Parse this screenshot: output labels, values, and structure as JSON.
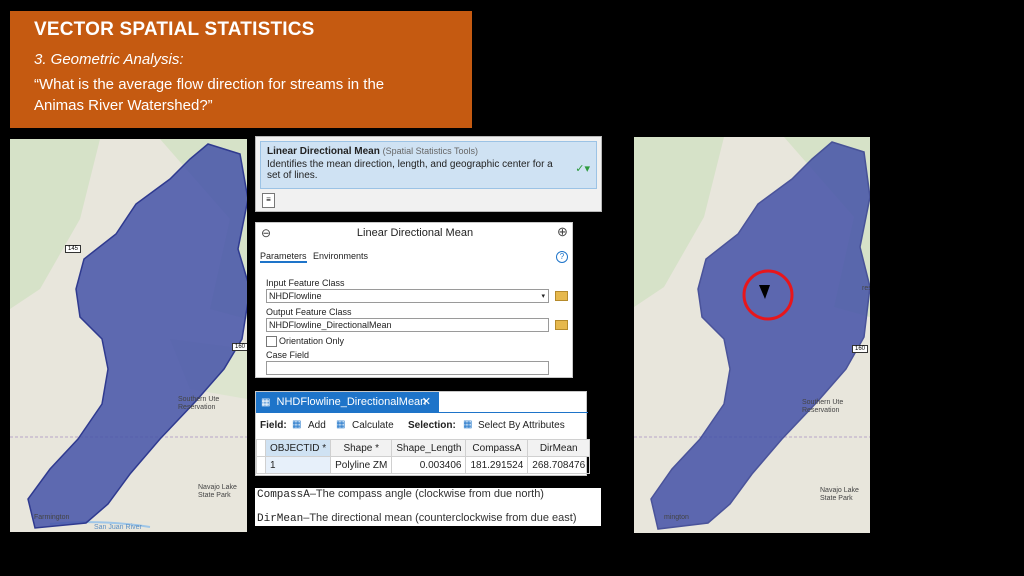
{
  "slide": {
    "title": "VECTOR SPATIAL STATISTICS",
    "subtitle": "3. Geometric Analysis:",
    "question": "“What is the average flow direction for streams in the Animas River Watershed?”"
  },
  "map_left": {
    "labels": {
      "route_145": "145",
      "route_160": "160",
      "southern_ute": "Southern Ute Reservation",
      "navajo_lake": "Navajo Lake State Park",
      "farmington": "Farmington",
      "san_juan": "San Juan River"
    }
  },
  "map_right": {
    "labels": {
      "route_160": "160",
      "forest": "rest",
      "southern_ute": "Southern Ute Reservation",
      "navajo_lake": "Navajo Lake State Park",
      "farmington": "mington"
    },
    "highlight_color": "#e8161b"
  },
  "tool_header": {
    "name": "Linear Directional Mean",
    "category": "(Spatial Statistics Tools)",
    "description": "Identifies the mean direction, length, and geographic center for a set of lines."
  },
  "gp_pane": {
    "title": "Linear Directional Mean",
    "tabs": [
      "Parameters",
      "Environments"
    ],
    "input_label": "Input Feature Class",
    "input_value": "NHDFlowline",
    "output_label": "Output Feature Class",
    "output_value": "NHDFlowline_DirectionalMean",
    "orientation_label": "Orientation Only",
    "orientation_checked": false,
    "case_label": "Case Field"
  },
  "attr_table": {
    "tab_label": "NHDFlowline_DirectionalMean",
    "field_label": "Field:",
    "add_label": "Add",
    "calculate_label": "Calculate",
    "selection_label": "Selection:",
    "select_by_attr_label": "Select By Attributes",
    "columns": [
      "OBJECTID *",
      "Shape *",
      "Shape_Length",
      "CompassA",
      "DirMean"
    ],
    "rows": [
      [
        "1",
        "Polyline ZM",
        "0.003406",
        "181.291524",
        "268.708476"
      ]
    ]
  },
  "definitions": {
    "compass_key": "CompassA",
    "compass_text": "–The compass angle (clockwise from due north)",
    "dirmean_key": "DirMean",
    "dirmean_text": "–The directional mean (counterclockwise from due east)"
  }
}
